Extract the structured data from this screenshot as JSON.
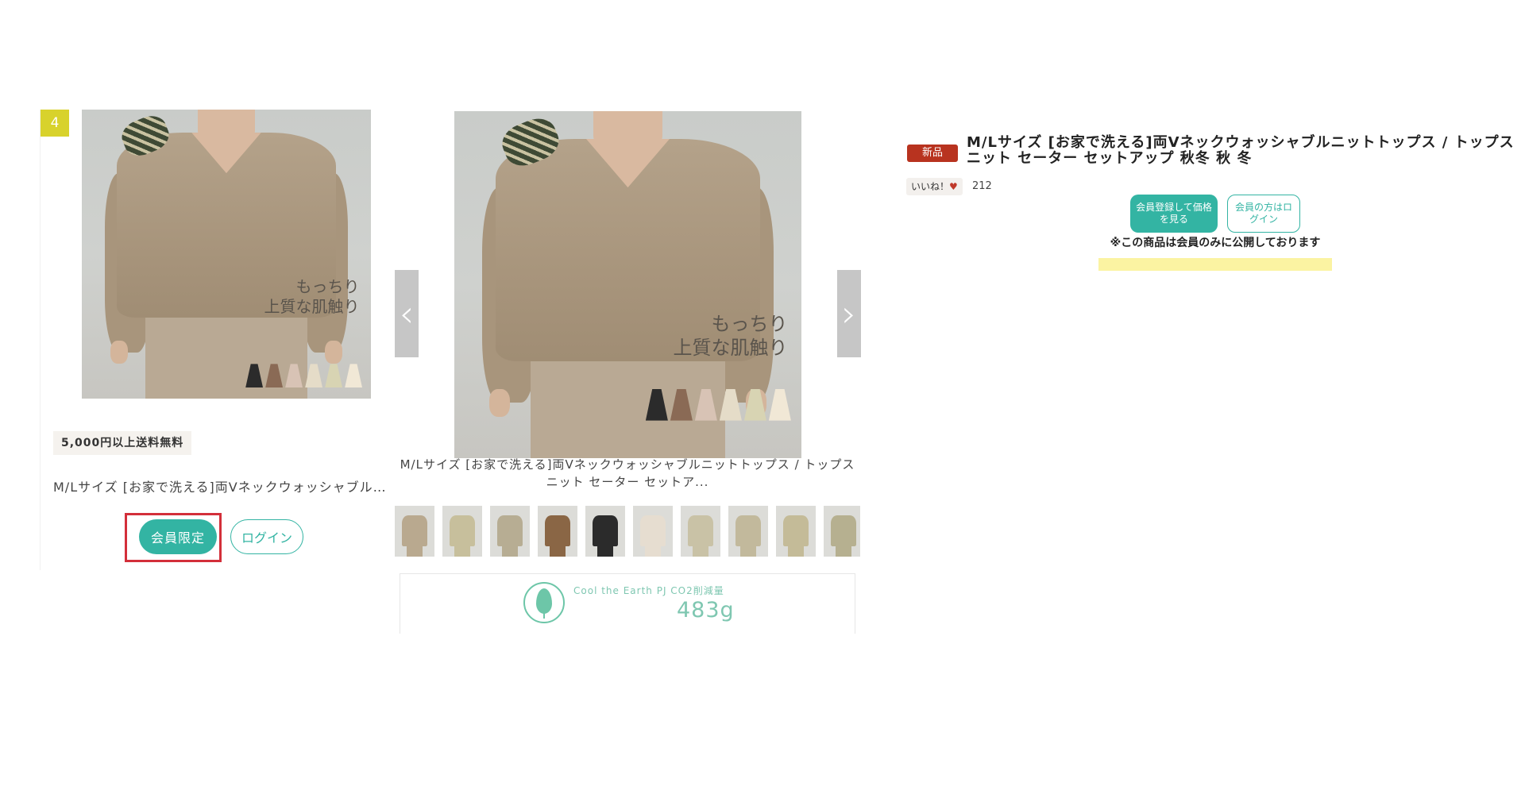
{
  "product_card": {
    "rank": "4",
    "shipping_badge": "5,000円以上送料無料",
    "title": "M/Lサイズ [お家で洗える]両Vネックウォッシャブルニットトップス / トップス ニット セーター セットアップ 秋冬 秋 冬",
    "members_only_label": "会員限定",
    "login_label": "ログイン",
    "image_tagline_line1": "もっちり",
    "image_tagline_line2": "上質な肌触り"
  },
  "gallery": {
    "main_tagline_line1": "もっちり",
    "main_tagline_line2": "上質な肌触り",
    "prev_arrow": "‹",
    "next_arrow": "›",
    "caption": "M/Lサイズ [お家で洗える]両Vネックウォッシャブルニットトップス / トップス ニット セーター セットア...",
    "thumbnails": [
      {
        "color": "#b9a98f"
      },
      {
        "color": "#c7bf9c"
      },
      {
        "color": "#b7ad93"
      },
      {
        "color": "#8a6645"
      },
      {
        "color": "#2b2b2b"
      },
      {
        "color": "#e6ddd0"
      },
      {
        "color": "#c9c2a6"
      },
      {
        "color": "#c2b99c"
      },
      {
        "color": "#c4bb98"
      },
      {
        "color": "#b6b090"
      }
    ],
    "eco": {
      "label": "Cool the Earth PJ CO2削減量",
      "value": "483g"
    }
  },
  "swatches": [
    "#2b2b2b",
    "#8a6a55",
    "#d8c3b5",
    "#e5dcc8",
    "#d8d4b3",
    "#f1e8d6"
  ],
  "detail": {
    "new_badge": "新品",
    "title": "M/Lサイズ [お家で洗える]両Vネックウォッシャブルニットトップス / トップス ニット セーター セットアップ 秋冬 秋 冬",
    "like_label": "いいね！",
    "like_icon": "♥",
    "like_count": "212",
    "register_label": "会員登録して価格を見る",
    "member_login_label": "会員の方はログイン",
    "members_note": "※この商品は会員のみに公開しております"
  },
  "colors": {
    "accent": "#33b4a3",
    "highlight_border": "#d32f3a",
    "new_badge": "#b8331f",
    "rank_badge": "#d8d22c",
    "eco": "#7fc7b1"
  }
}
